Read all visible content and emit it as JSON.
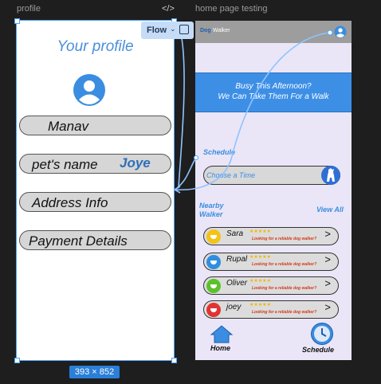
{
  "canvas": {
    "profile_frame_label": "profile",
    "home_frame_label": "home page testing",
    "code_icon": "</>",
    "size_badge": "393 × 852",
    "flow_label": "Flow"
  },
  "profile": {
    "title": "Your profile",
    "fields": [
      "Manav",
      "pet's name",
      "Address Info",
      "Payment Details"
    ],
    "pet_name_value": "Joye"
  },
  "home": {
    "brand_first": "Dog",
    "brand_second": "Walker",
    "banner_line1": "Busy This Afternoon?",
    "banner_line2": "We Can Take Them For a Walk",
    "schedule_heading": "Schedule",
    "choose_time": "Choose a Time",
    "nearby_heading_line1": "Nearby",
    "nearby_heading_line2": "Walker",
    "view_all": "View All",
    "walkers": [
      {
        "name": "Sara",
        "stars": "★★★★★",
        "tag": "Looking for a reliable dog walker?",
        "color": "#f3c316"
      },
      {
        "name": "Rupal",
        "stars": "★★★★★",
        "tag": "Looking for a reliable dog walker?",
        "color": "#2f8ee0"
      },
      {
        "name": "Oliver",
        "stars": "★★★★★",
        "tag": "Looking for a reliable dog walker?",
        "color": "#5cc12a"
      },
      {
        "name": "joey",
        "stars": "★★★★★",
        "tag": "Looking for a reliable dog walker?",
        "color": "#e03434"
      }
    ],
    "nav_home": "Home",
    "nav_schedule": "Schedule"
  },
  "colors": {
    "accent_blue": "#3a8de0",
    "banner_blue": "#3d8fe6",
    "selection_blue": "#4da3ff"
  }
}
